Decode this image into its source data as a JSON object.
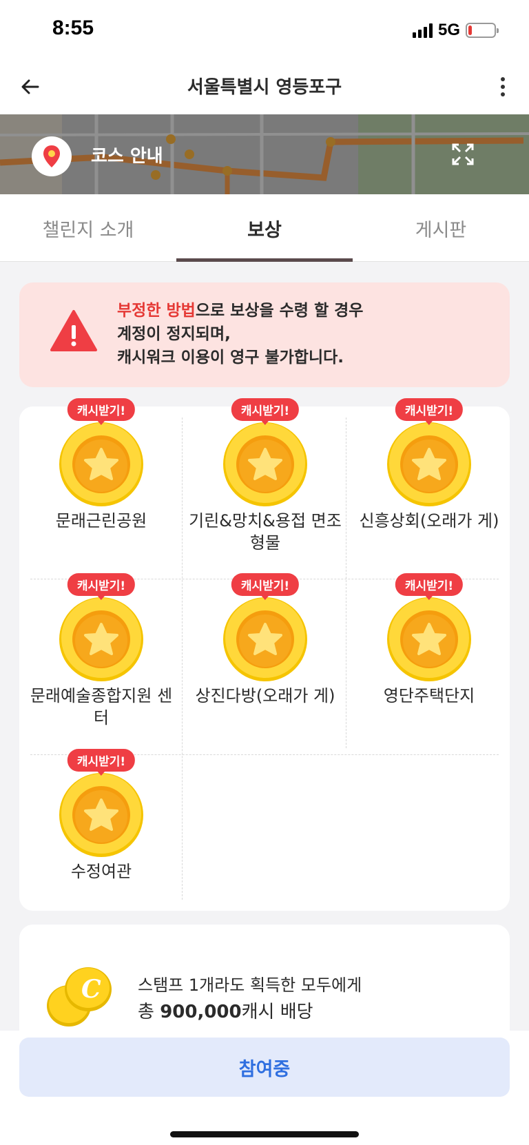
{
  "status_bar": {
    "time": "8:55",
    "network": "5G",
    "battery_level": 0.15,
    "battery_color": "#e53935"
  },
  "header": {
    "title": "서울특별시 영등포구",
    "back_icon": "arrow-left-icon",
    "more_icon": "more-vertical-icon"
  },
  "map_banner": {
    "label": "코스 안내",
    "pin_icon": "location-pin-icon",
    "expand_icon": "expand-icon"
  },
  "tabs": [
    {
      "label": "챌린지 소개",
      "active": false
    },
    {
      "label": "보상",
      "active": true
    },
    {
      "label": "게시판",
      "active": false
    }
  ],
  "warning": {
    "icon": "warning-triangle-icon",
    "highlight": "부정한 방법",
    "line1_rest": "으로 보상을 수령 할 경우",
    "line2": "계정이 정지되며,",
    "line3": "캐시워크 이용이 영구 불가합니다.",
    "highlight_color": "#e53935"
  },
  "stamps": [
    {
      "badge": "캐시받기!",
      "label": "문래근린공원"
    },
    {
      "badge": "캐시받기!",
      "label": "기린&망치&용접 면조형물"
    },
    {
      "badge": "캐시받기!",
      "label": "신흥상회(오래가 게)"
    },
    {
      "badge": "캐시받기!",
      "label": "문래예술종합지원 센터"
    },
    {
      "badge": "캐시받기!",
      "label": "상진다방(오래가 게)"
    },
    {
      "badge": "캐시받기!",
      "label": "영단주택단지"
    },
    {
      "badge": "캐시받기!",
      "label": "수정여관"
    }
  ],
  "reward": {
    "line1": "스탬프 1개라도 획득한 모두에게",
    "line2_prefix": "총 ",
    "amount": "900,000",
    "line2_suffix": "캐시 배당",
    "coin_icon": "cash-coins-icon"
  },
  "join_button": {
    "label": "참여중",
    "color": "#2f6fe0"
  }
}
